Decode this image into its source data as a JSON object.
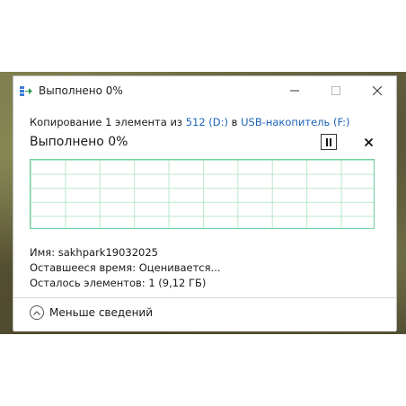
{
  "window": {
    "title": "Выполнено 0%",
    "controls": {
      "minimize": "minimize",
      "maximize": "maximize",
      "close": "close"
    }
  },
  "copy": {
    "prefix": "Копирование 1 элемента из",
    "source": "512 (D:)",
    "middle": "в",
    "destination": "USB-накопитель (F:)"
  },
  "progress": {
    "label": "Выполнено 0%",
    "percent": 0
  },
  "details": {
    "name_label": "Имя:",
    "name_value": "sakhpark19032025",
    "time_label": "Оставшееся время:",
    "time_value": "Оценивается...",
    "items_label": "Осталось элементов:",
    "items_value": "1 (9,12 ГБ)"
  },
  "footer": {
    "less_details_label": "Меньше сведений"
  },
  "colors": {
    "graph_border": "#6fcf9f",
    "graph_grid": "#b7e7cb",
    "link": "#1c63b7"
  }
}
